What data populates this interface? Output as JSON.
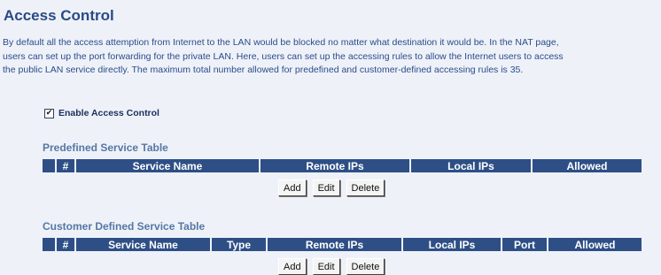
{
  "page": {
    "title": "Access Control",
    "description_lines": [
      "By default all the access attemption from Internet to the LAN would be blocked no matter what destination it would be. In the NAT page,",
      "users can set up the port forwarding for the private LAN. Here, users can set up the accessing rules to allow the Internet users to access",
      "the public LAN service directly. The maximum total number allowed for predefined and customer-defined accessing rules is 35."
    ]
  },
  "enable_access_control": {
    "label": "Enable Access Control",
    "checked": true,
    "check_glyph": "✔"
  },
  "predefined": {
    "title": "Predefined Service Table",
    "columns": [
      "",
      "#",
      "Service Name",
      "Remote IPs",
      "Local IPs",
      "Allowed"
    ],
    "buttons": {
      "add": "Add",
      "edit": "Edit",
      "delete": "Delete"
    }
  },
  "customer": {
    "title": "Customer Defined Service Table",
    "columns": [
      "",
      "#",
      "Service Name",
      "Type",
      "Remote IPs",
      "Local IPs",
      "Port",
      "Allowed"
    ],
    "buttons": {
      "add": "Add",
      "edit": "Edit",
      "delete": "Delete"
    }
  },
  "colors": {
    "header_bg": "#2e4f86",
    "page_bg": "#eef2f8",
    "title": "#2a4a86",
    "section_title": "#5676a5"
  }
}
